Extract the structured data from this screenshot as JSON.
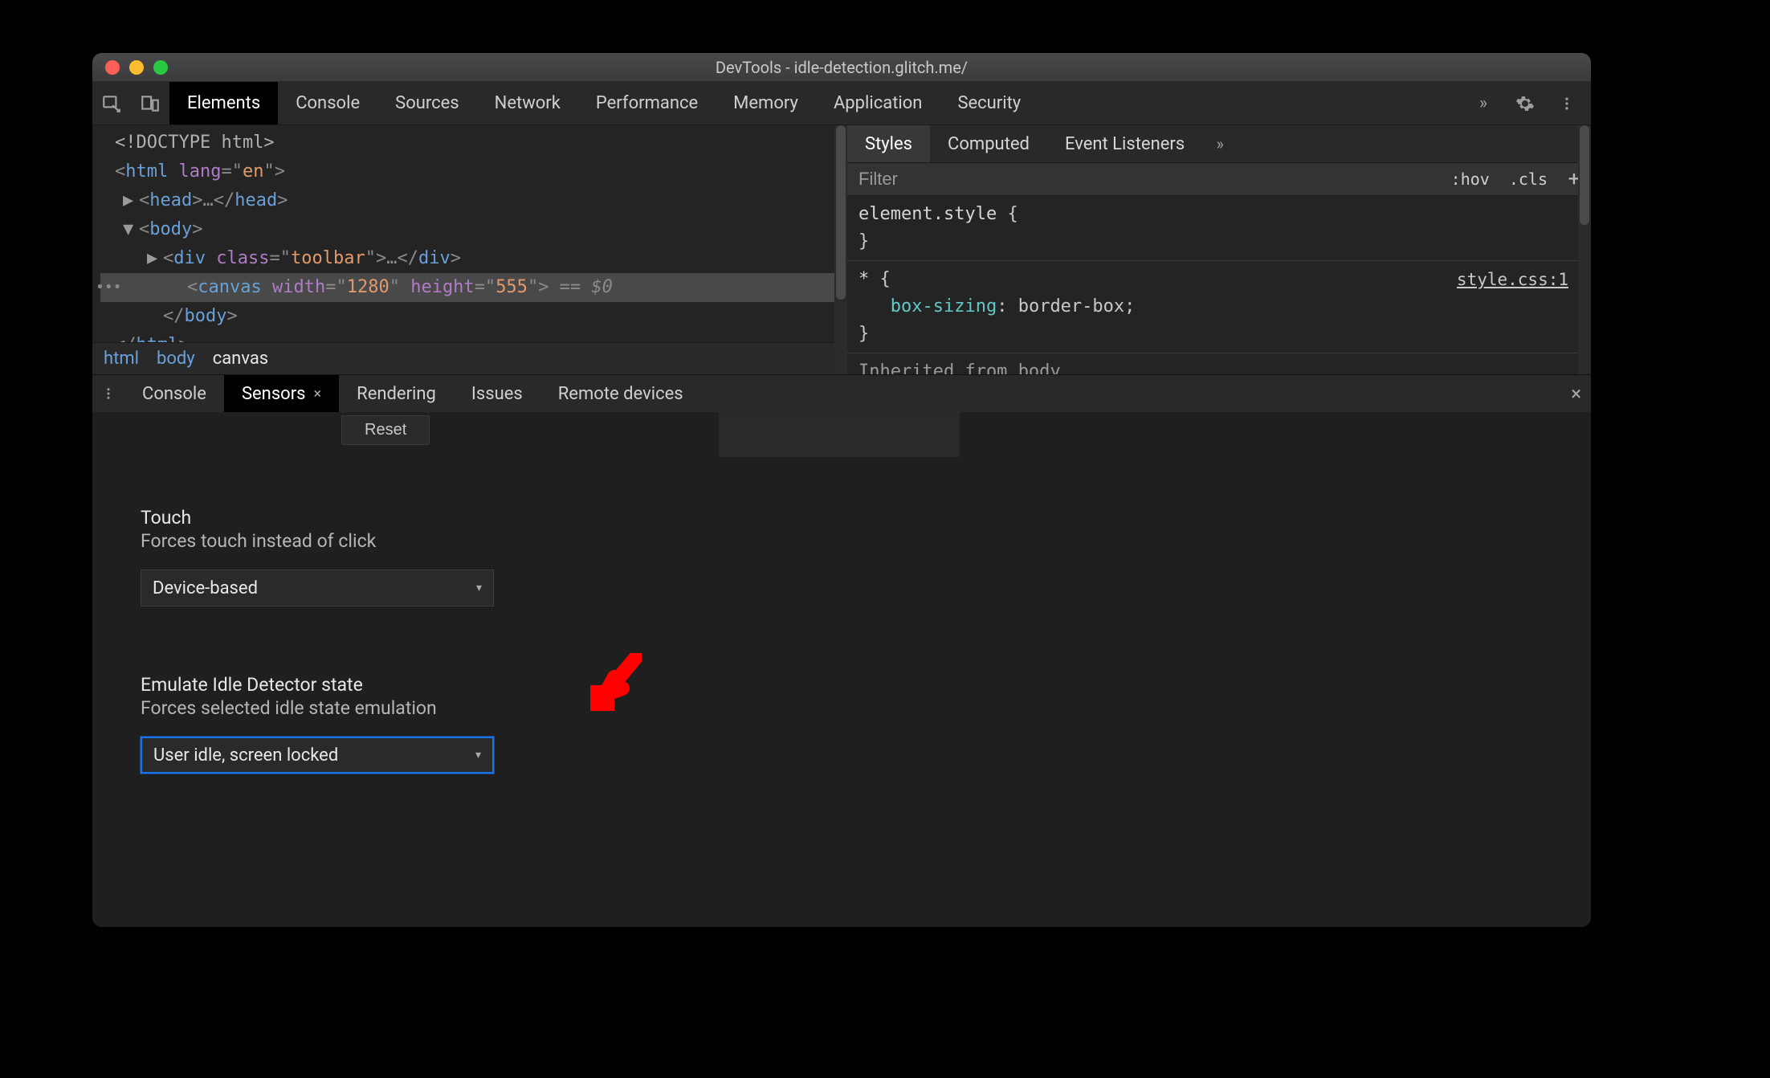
{
  "titlebar": {
    "title": "DevTools - idle-detection.glitch.me/"
  },
  "mainTabs": {
    "items": [
      "Elements",
      "Console",
      "Sources",
      "Network",
      "Performance",
      "Memory",
      "Application",
      "Security"
    ],
    "activeIndex": 0,
    "overflowGlyph": "»"
  },
  "dom": {
    "lines": [
      {
        "indent": 0,
        "caret": "",
        "seg": [
          [
            "doctype",
            "<!DOCTYPE html>"
          ]
        ]
      },
      {
        "indent": 0,
        "caret": "",
        "seg": [
          [
            "angle",
            "<"
          ],
          [
            "tag",
            "html"
          ],
          [
            "plain",
            " "
          ],
          [
            "attr",
            "lang"
          ],
          [
            "angle",
            "=\""
          ],
          [
            "val",
            "en"
          ],
          [
            "angle",
            "\">"
          ]
        ]
      },
      {
        "indent": 1,
        "caret": "▶",
        "seg": [
          [
            "angle",
            "<"
          ],
          [
            "tag",
            "head"
          ],
          [
            "angle",
            ">"
          ],
          [
            "dim",
            "…"
          ],
          [
            "angle",
            "</"
          ],
          [
            "tag",
            "head"
          ],
          [
            "angle",
            ">"
          ]
        ]
      },
      {
        "indent": 1,
        "caret": "▼",
        "seg": [
          [
            "angle",
            "<"
          ],
          [
            "tag",
            "body"
          ],
          [
            "angle",
            ">"
          ]
        ]
      },
      {
        "indent": 2,
        "caret": "▶",
        "seg": [
          [
            "angle",
            "<"
          ],
          [
            "tag",
            "div"
          ],
          [
            "plain",
            " "
          ],
          [
            "attr",
            "class"
          ],
          [
            "angle",
            "=\""
          ],
          [
            "val",
            "toolbar"
          ],
          [
            "angle",
            "\">"
          ],
          [
            "dim",
            "…"
          ],
          [
            "angle",
            "</"
          ],
          [
            "tag",
            "div"
          ],
          [
            "angle",
            ">"
          ]
        ]
      },
      {
        "indent": 3,
        "selected": true,
        "ellipsis": true,
        "seg": [
          [
            "angle",
            "<"
          ],
          [
            "tag",
            "canvas"
          ],
          [
            "plain",
            " "
          ],
          [
            "attr",
            "width"
          ],
          [
            "angle",
            "=\""
          ],
          [
            "val",
            "1280"
          ],
          [
            "angle",
            "\" "
          ],
          [
            "attr",
            "height"
          ],
          [
            "angle",
            "=\""
          ],
          [
            "val",
            "555"
          ],
          [
            "angle",
            "\">"
          ],
          [
            "dim",
            " == "
          ],
          [
            "dollar",
            "$0"
          ]
        ]
      },
      {
        "indent": 2,
        "seg": [
          [
            "angle",
            "</"
          ],
          [
            "tag",
            "body"
          ],
          [
            "angle",
            ">"
          ]
        ]
      },
      {
        "indent": 0,
        "seg": [
          [
            "angle",
            "</"
          ],
          [
            "tag",
            "html"
          ],
          [
            "angle",
            ">"
          ]
        ]
      }
    ],
    "breadcrumb": [
      "html",
      "body",
      "canvas"
    ]
  },
  "styles": {
    "tabs": [
      "Styles",
      "Computed",
      "Event Listeners"
    ],
    "activeIndex": 0,
    "overflowGlyph": "»",
    "filterPlaceholder": "Filter",
    "hov": ":hov",
    "cls": ".cls",
    "rules": {
      "elementStyleSel": "element.style",
      "braceOpen": "{",
      "braceClose": "}",
      "starSel": "*",
      "starSrc": "style.css:1",
      "starProp": "box-sizing",
      "starVal": "border-box",
      "inheritText": "Inherited from",
      "inheritTag": "body"
    }
  },
  "drawer": {
    "tabs": [
      "Console",
      "Sensors",
      "Rendering",
      "Issues",
      "Remote devices"
    ],
    "activeIndex": 1,
    "closeGlyph": "×",
    "resetLabel": "Reset",
    "touch": {
      "title": "Touch",
      "desc": "Forces touch instead of click",
      "value": "Device-based"
    },
    "idle": {
      "title": "Emulate Idle Detector state",
      "desc": "Forces selected idle state emulation",
      "value": "User idle, screen locked"
    }
  },
  "colors": {
    "annotation": "#ff0000",
    "focusRing": "#1a73e8"
  }
}
